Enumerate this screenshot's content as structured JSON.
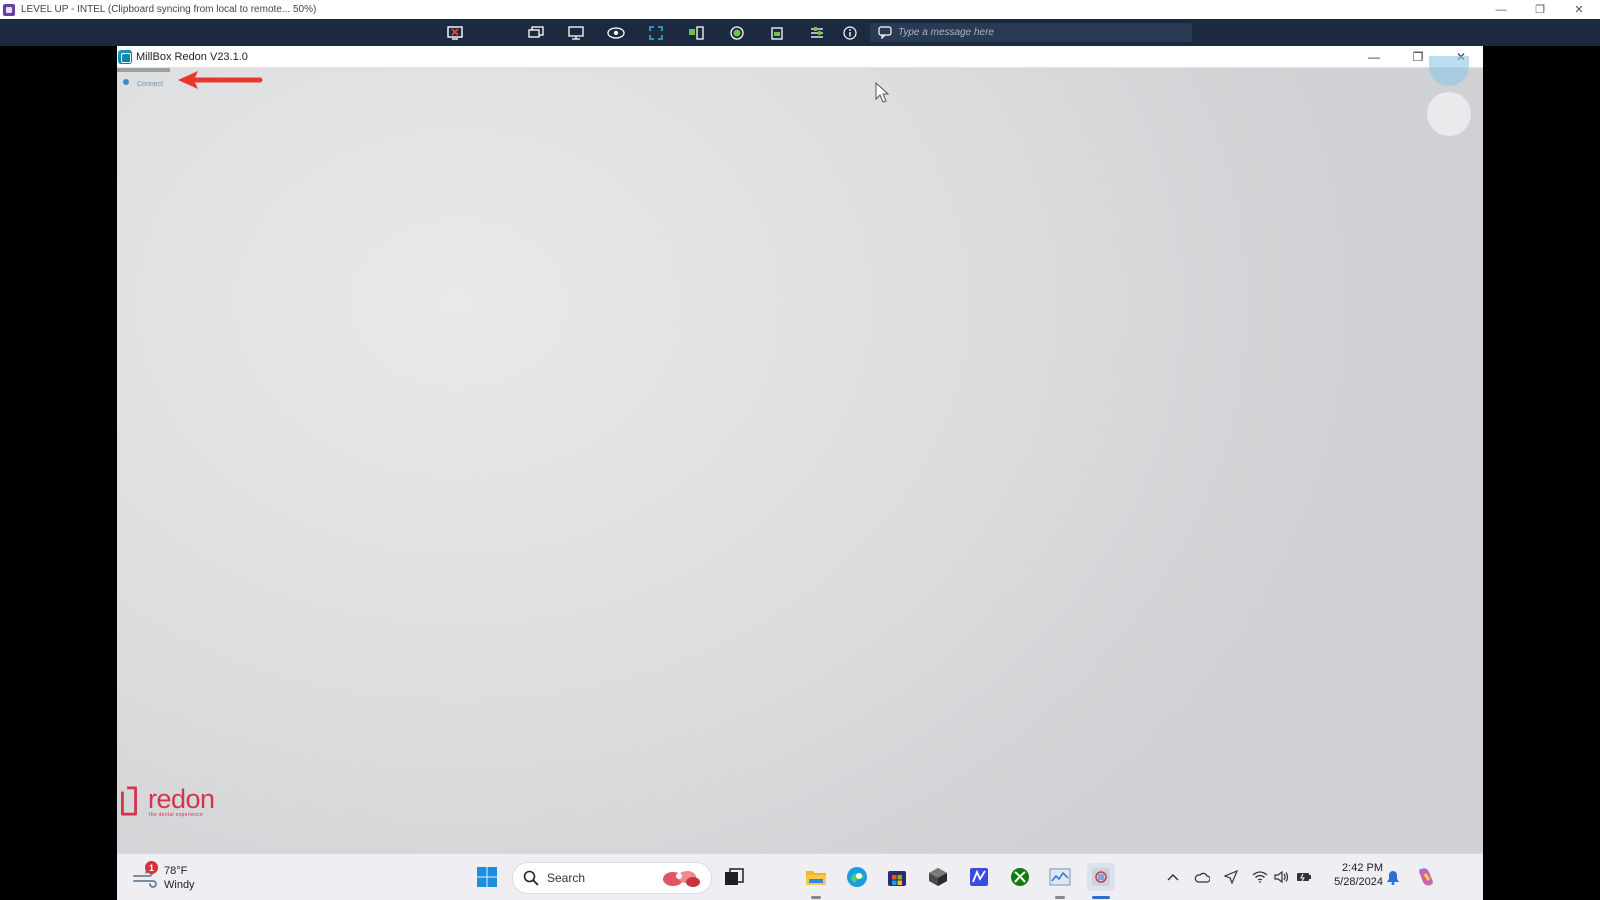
{
  "host": {
    "title": "LEVEL UP - INTEL (Clipboard syncing from local to remote... 50%)",
    "minimize_glyph": "—",
    "restore_glyph": "❐",
    "close_glyph": "✕"
  },
  "toolbar": {
    "message_placeholder": "Type a message here"
  },
  "remote_window": {
    "title": "MillBox Redon V23.1.0",
    "minimize_glyph": "—",
    "restore_glyph": "❐",
    "close_glyph": "✕"
  },
  "content": {
    "tiny_label": "Connect"
  },
  "logo": {
    "word": "redon",
    "tagline": "the dental experience"
  },
  "taskbar": {
    "weather": {
      "badge": "1",
      "temp": "78°F",
      "condition": "Windy"
    },
    "search_label": "Search",
    "clock": {
      "time": "2:42 PM",
      "date": "5/28/2024"
    }
  },
  "colors": {
    "toolbar_bg": "#1b2a3f",
    "accent_red": "#d7344a",
    "arrow_red": "#e8372d",
    "taskbar_bg": "#eeeef3"
  }
}
